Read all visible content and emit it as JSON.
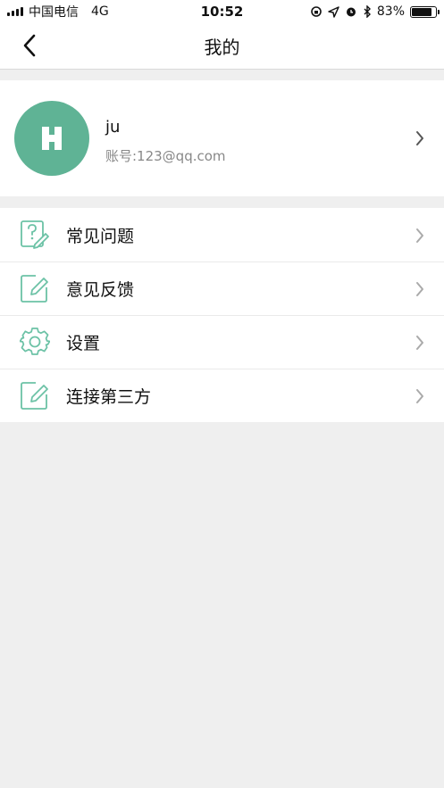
{
  "status_bar": {
    "carrier": "中国电信",
    "network": "4G",
    "time": "10:52",
    "battery_percent": "83%",
    "battery_level": 0.83
  },
  "nav": {
    "title": "我的",
    "back_icon": "chevron-left-icon"
  },
  "profile": {
    "avatar_letter_icon": "h-logo-icon",
    "name": "ju",
    "account": "账号:123@qq.com"
  },
  "menu": {
    "items": [
      {
        "label": "常见问题",
        "icon": "question-document-icon"
      },
      {
        "label": "意见反馈",
        "icon": "edit-note-icon"
      },
      {
        "label": "设置",
        "icon": "gear-icon"
      },
      {
        "label": "连接第三方",
        "icon": "edit-note-icon"
      }
    ]
  },
  "colors": {
    "accent": "#5fb395",
    "background": "#efefef",
    "icon_stroke": "#6cc2a6"
  }
}
